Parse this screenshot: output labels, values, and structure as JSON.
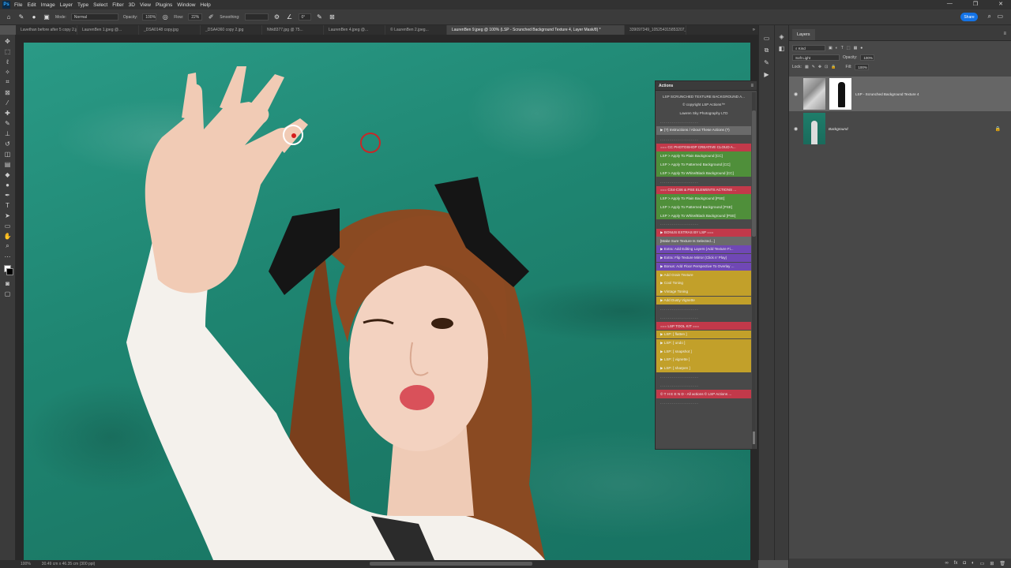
{
  "menubar": {
    "logo": "Ps",
    "items": [
      "File",
      "Edit",
      "Image",
      "Layer",
      "Type",
      "Select",
      "Filter",
      "3D",
      "View",
      "Plugins",
      "Window",
      "Help"
    ],
    "window_controls": [
      "—",
      "❐",
      "✕"
    ]
  },
  "options": {
    "mode_label": "Mode:",
    "mode_value": "Normal",
    "opacity_label": "Opacity:",
    "opacity_value": "100%",
    "flow_label": "Flow:",
    "flow_value": "22%",
    "smoothing_label": "Smoothing:",
    "angle_value": "0°",
    "share_label": "Share"
  },
  "tabs": [
    {
      "label": "Lavethan before after 5 copy 2.jpg",
      "active": false
    },
    {
      "label": "LaurenBen 1.jpeg @...",
      "active": false
    },
    {
      "label": "_DSA0148 copy.jpg",
      "active": false
    },
    {
      "label": "_DSA4360 copy 2.jpg",
      "active": false
    },
    {
      "label": "Nhk8377.jpg @ 75...",
      "active": false
    },
    {
      "label": "LaurenBen 4.jpeg @...",
      "active": false
    },
    {
      "label": "© LaurenBen 2.jpeg...",
      "active": false
    },
    {
      "label": "LaurenBen 9.jpeg @ 100% (LSP - Scrunched Background Texture 4, Layer Mask/8) *",
      "active": true
    },
    {
      "label": "339097349_105254315853207_398435872735...",
      "active": false
    }
  ],
  "status": {
    "zoom": "100%",
    "doc_size": "30.49 cm x 46.35 cm (300 ppi)"
  },
  "actions_panel": {
    "title": "Actions",
    "rows": [
      {
        "text": "LSP SCRUNCHED TEXTURE BACKGROUND A...",
        "bg": "#494949",
        "style": "plain"
      },
      {
        "text": "© copyright LSP Actions™",
        "bg": "#494949",
        "style": "plain"
      },
      {
        "text": "Lawren Sky Photography LTD",
        "bg": "#494949",
        "style": "plain"
      },
      {
        "text": "- - - - - - - - - - - - - - - - - - - -",
        "bg": "#494949",
        "style": "sep"
      },
      {
        "text": "▶ (?) Instructions / About These Actions (?)",
        "bg": "#6a6a6a",
        "style": "item"
      },
      {
        "text": "- - - - - - - - - - - - - - - - - - - -",
        "bg": "#494949",
        "style": "sep"
      },
      {
        "text": "=== CC PHOTOSHOP CREATIVE CLOUD A...",
        "bg": "#c2394a",
        "style": "item"
      },
      {
        "text": "LSP > Apply To Plain Background [CC]",
        "bg": "#4f8f3a",
        "style": "item"
      },
      {
        "text": "LSP > Apply To Patterned Background [CC]",
        "bg": "#4f8f3a",
        "style": "item"
      },
      {
        "text": "LSP > Apply To White/Black Background [CC]",
        "bg": "#4f8f3a",
        "style": "item"
      },
      {
        "text": "- - - - - - - - - - - - - - - - - - - -",
        "bg": "#494949",
        "style": "sep"
      },
      {
        "text": "=== CS4-CS6 & PSE ELEMENTS ACTIONS ...",
        "bg": "#c2394a",
        "style": "item"
      },
      {
        "text": "LSP > Apply To Plain Background [PSE]",
        "bg": "#4f8f3a",
        "style": "item"
      },
      {
        "text": "LSP > Apply To Patterned Background [PSE]",
        "bg": "#4f8f3a",
        "style": "item"
      },
      {
        "text": "LSP > Apply To White/Black Background [PSE]",
        "bg": "#4f8f3a",
        "style": "item"
      },
      {
        "text": "- - - - - - - - - - - - - - - - - - - -",
        "bg": "#494949",
        "style": "sep"
      },
      {
        "text": "▶ BONUS EXTRAS BY LSP ===",
        "bg": "#c2394a",
        "style": "item"
      },
      {
        "text": "[Make Sure Texture Is Selected...]",
        "bg": "#6a6a6a",
        "style": "item"
      },
      {
        "text": "▶ Extra: Add Editing Layers (Add Texture Fi...",
        "bg": "#7048b5",
        "style": "item"
      },
      {
        "text": "▶ Extra: Flip Texture Mirror (Click n' Play)",
        "bg": "#7048b5",
        "style": "item"
      },
      {
        "text": "▶ Bonus: Add Floor Perspective To Overlay ...",
        "bg": "#7048b5",
        "style": "item"
      },
      {
        "text": "▶ Add Grain Texture",
        "bg": "#c2a02a",
        "style": "item"
      },
      {
        "text": "▶ Cool Toning",
        "bg": "#c2a02a",
        "style": "item"
      },
      {
        "text": "▶ Vintage Toning",
        "bg": "#c2a02a",
        "style": "item"
      },
      {
        "text": "▶ Add Dusty Vignette",
        "bg": "#c2a02a",
        "style": "item"
      },
      {
        "text": "- - - - - - - - - - - - - - - - - - - -",
        "bg": "#494949",
        "style": "sep"
      },
      {
        "text": "- - - - - - - - - - - - - - - - - - - -",
        "bg": "#494949",
        "style": "sep"
      },
      {
        "text": "=== LSP TOOL KIT ===",
        "bg": "#c2394a",
        "style": "item"
      },
      {
        "text": "▶ LSP: [ flatten ]",
        "bg": "#c2a02a",
        "style": "item"
      },
      {
        "text": "▶ LSP: [ undo ]",
        "bg": "#c2a02a",
        "style": "item"
      },
      {
        "text": "▶ LSP: [ snapshot ]",
        "bg": "#c2a02a",
        "style": "item"
      },
      {
        "text": "▶ LSP: [ vignette ]",
        "bg": "#c2a02a",
        "style": "item"
      },
      {
        "text": "▶ LSP: [ sharpen ]",
        "bg": "#c2a02a",
        "style": "item"
      },
      {
        "text": "- - - - - - - - - - - - - - - - - - - -",
        "bg": "#494949",
        "style": "sep"
      },
      {
        "text": "- - - - - - - - - - - - - - - - - - - -",
        "bg": "#494949",
        "style": "sep"
      },
      {
        "text": "© T H E  E N D - All actions © LSP Actions ...",
        "bg": "#c2394a",
        "style": "item"
      },
      {
        "text": "- - - - - - - - - - - - - - - - - - - -",
        "bg": "#494949",
        "style": "sep"
      }
    ]
  },
  "layers_panel": {
    "tab": "Layers",
    "kind_label": "Kind",
    "blend_mode": "Soft Light",
    "opacity_label": "Opacity:",
    "opacity_value": "100%",
    "lock_label": "Lock:",
    "fill_label": "Fill:",
    "fill_value": "100%",
    "layers": [
      {
        "name": "LSP - Scrunched Background Texture 4",
        "selected": true
      },
      {
        "name": "Background",
        "selected": false
      }
    ]
  }
}
